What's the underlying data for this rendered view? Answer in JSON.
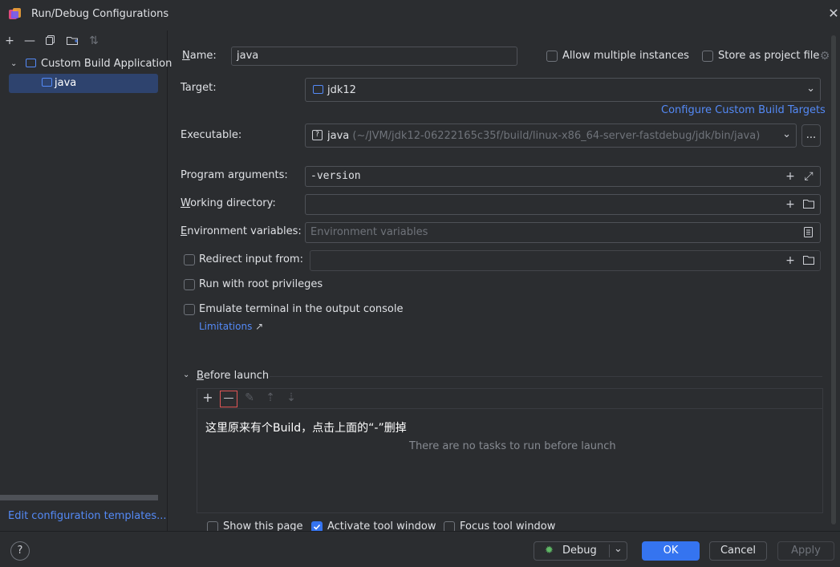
{
  "window": {
    "title": "Run/Debug Configurations"
  },
  "tree": {
    "group_label": "Custom Build Application",
    "item_label": "java"
  },
  "left_footer": {
    "templates_link": "Edit configuration templates..."
  },
  "form": {
    "name_label": "Name:",
    "name_value": "java",
    "allow_multiple_label": "Allow multiple instances",
    "store_project_label": "Store as project file",
    "target_label": "Target:",
    "target_value": "jdk12",
    "configure_targets_link": "Configure Custom Build Targets",
    "executable_label": "Executable:",
    "executable_name": "java",
    "executable_path": "(~/JVM/jdk12-06222165c35f/build/linux-x86_64-server-fastdebug/jdk/bin/java)",
    "executable_more": "...",
    "program_args_label": "Program arguments:",
    "program_args_value": "-version",
    "working_dir_label": "Working directory:",
    "working_dir_value": "",
    "env_vars_label": "Environment variables:",
    "env_vars_placeholder": "Environment variables",
    "redirect_label": "Redirect input from:",
    "root_priv_label": "Run with root privileges",
    "emulate_label": "Emulate terminal in the output console",
    "limitations_link": "Limitations",
    "before_launch_label": "Before launch",
    "annotation_text": "这里原来有个Build，点击上面的“-”删掉",
    "no_tasks_text": "There are no tasks to run before launch",
    "show_page_label": "Show this page",
    "activate_tool_label": "Activate tool window",
    "focus_tool_label": "Focus tool window"
  },
  "footer": {
    "help": "?",
    "debug_label": "Debug",
    "ok_label": "OK",
    "cancel_label": "Cancel",
    "apply_label": "Apply"
  },
  "colors": {
    "accent": "#3574f0",
    "link": "#548af7",
    "highlight_border": "#e05555",
    "bg": "#2b2d30"
  }
}
